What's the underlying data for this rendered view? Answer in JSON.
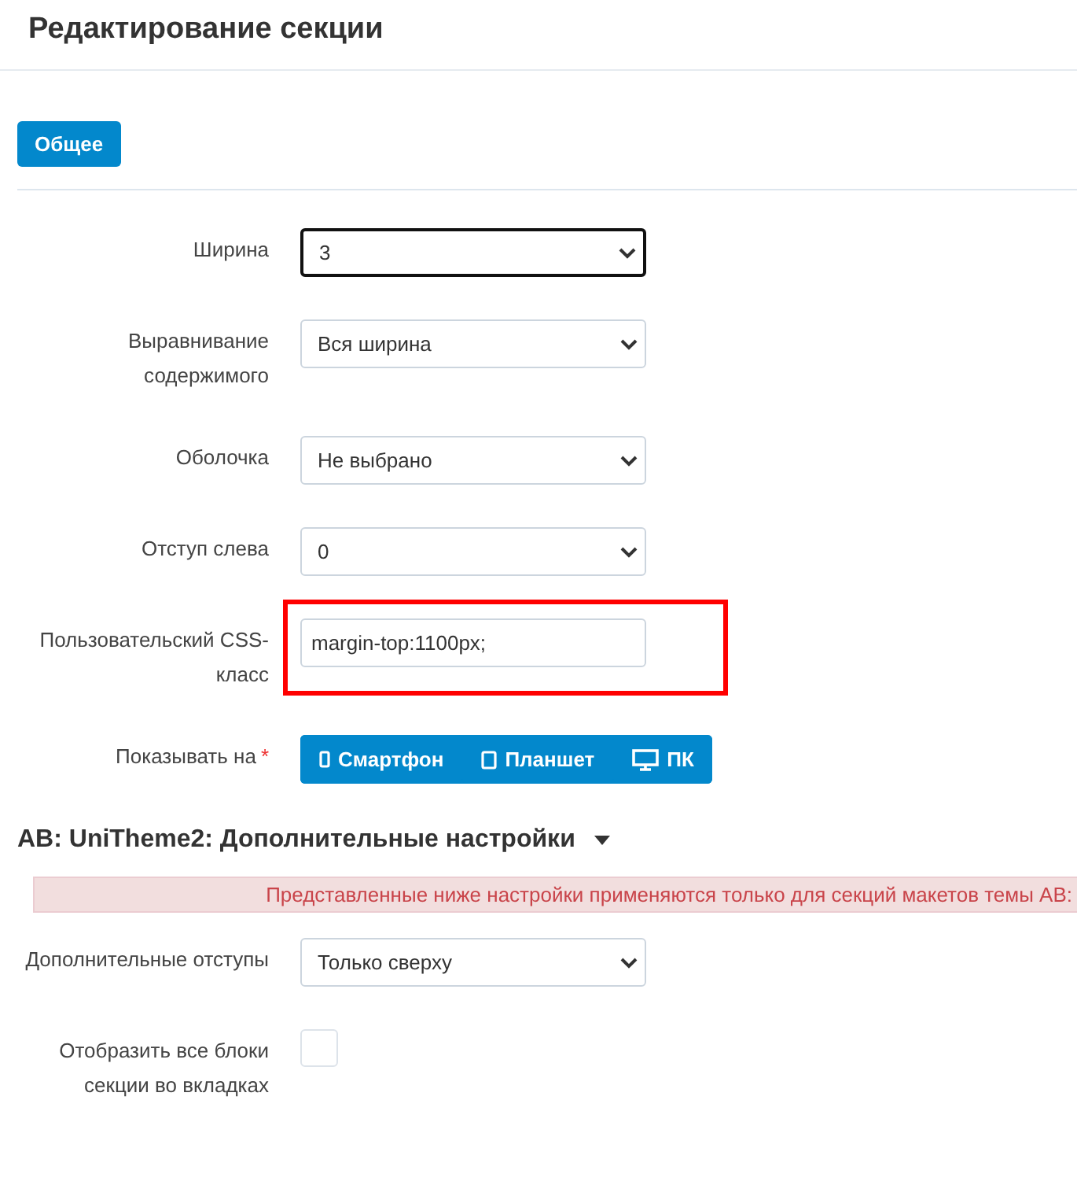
{
  "page_title": "Редактирование секции",
  "tabs": [
    {
      "label": "Общее",
      "selected": true
    }
  ],
  "fields": [
    {
      "kind": "select",
      "label": "Ширина",
      "value": "3",
      "focused": true
    },
    {
      "kind": "select",
      "label": "Выравнивание содержимого",
      "value": "Вся ширина",
      "focused": false
    },
    {
      "kind": "select",
      "label": "Оболочка",
      "value": "Не выбрано",
      "focused": false
    },
    {
      "kind": "select",
      "label": "Отступ слева",
      "value": "0",
      "focused": false
    },
    {
      "kind": "text",
      "label": "Пользовательский CSS-класс",
      "value": "margin-top:1100px;",
      "highlighted": true
    },
    {
      "kind": "devices",
      "label": "Показывать на",
      "required_mark": "*",
      "devices": [
        {
          "kind": "phone",
          "label": "Смартфон"
        },
        {
          "kind": "tablet",
          "label": "Планшет"
        },
        {
          "kind": "desktop",
          "label": "ПК"
        }
      ]
    }
  ],
  "addon_section": {
    "title": "AB: UniTheme2: Дополнительные настройки",
    "expanded": true,
    "notice": "Представленные ниже настройки применяются только для секций макетов темы AB:",
    "fields": [
      {
        "kind": "select",
        "label": "Дополнительные отступы",
        "value": "Только сверху",
        "focused": false
      },
      {
        "kind": "checkbox",
        "label": "Отобразить все блоки секции во вкладках",
        "checked": false
      }
    ]
  }
}
